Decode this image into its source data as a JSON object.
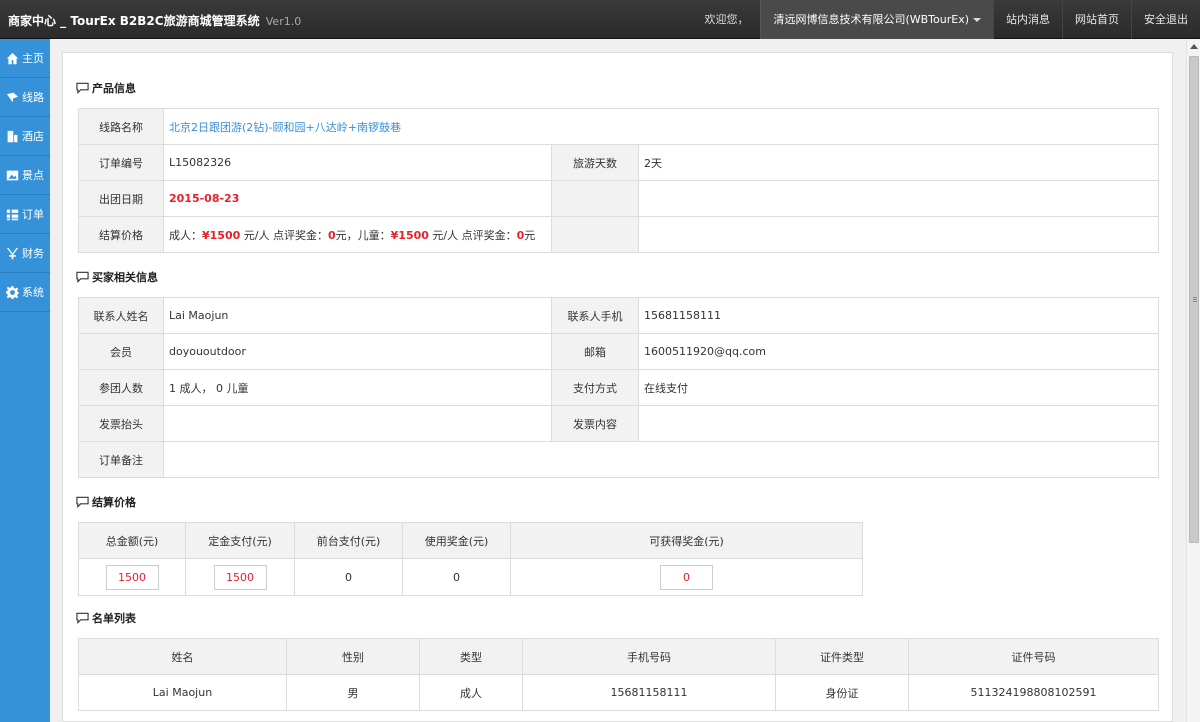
{
  "header": {
    "brand": "商家中心 _ TourEx B2B2C旅游商城管理系统",
    "version": "Ver1.0",
    "welcome": "欢迎您，",
    "company": "清远网博信息技术有限公司(WBTourEx)",
    "messages": "站内消息",
    "homepage": "网站首页",
    "logout": "安全退出"
  },
  "sidebar": {
    "items": [
      {
        "label": "主页",
        "icon": "home-icon"
      },
      {
        "label": "线路",
        "icon": "route-icon"
      },
      {
        "label": "酒店",
        "icon": "building-icon"
      },
      {
        "label": "景点",
        "icon": "picture-icon"
      },
      {
        "label": "订单",
        "icon": "list-icon"
      },
      {
        "label": "财务",
        "icon": "yen-icon"
      },
      {
        "label": "系统",
        "icon": "gear-icon"
      }
    ]
  },
  "product": {
    "title": "产品信息",
    "route_label": "线路名称",
    "route_value": "北京2日跟团游(2钻)-颐和园+八达岭+南锣鼓巷",
    "order_no_label": "订单编号",
    "order_no_value": "L15082326",
    "days_label": "旅游天数",
    "days_value": "2天",
    "depart_label": "出团日期",
    "depart_value": "2015-08-23",
    "price_label": "结算价格",
    "price_adult_prefix": "成人：",
    "price_adult": "¥1500",
    "price_adult_mid": " 元/人 点评奖金：",
    "price_adult_bonus": "0",
    "price_child_prefix": "元，儿童：",
    "price_child": "¥1500",
    "price_child_mid": " 元/人 点评奖金：",
    "price_child_bonus": "0",
    "price_suffix": "元"
  },
  "buyer": {
    "title": "买家相关信息",
    "contact_name_label": "联系人姓名",
    "contact_name_value": "Lai Maojun",
    "contact_phone_label": "联系人手机",
    "contact_phone_value": "15681158111",
    "member_label": "会员",
    "member_value": "doyououtdoor",
    "email_label": "邮箱",
    "email_value": "1600511920@qq.com",
    "people_label": "参团人数",
    "people_value": "1 成人， 0 儿童",
    "pay_label": "支付方式",
    "pay_value": "在线支付",
    "invoice_title_label": "发票抬头",
    "invoice_content_label": "发票内容",
    "remark_label": "订单备注"
  },
  "settlement": {
    "title": "结算价格",
    "headers": [
      "总金额(元)",
      "定金支付(元)",
      "前台支付(元)",
      "使用奖金(元)",
      "可获得奖金(元)"
    ],
    "total": "1500",
    "deposit": "1500",
    "front_pay": "0",
    "bonus_used": "0",
    "bonus_earn": "0"
  },
  "roster": {
    "title": "名单列表",
    "headers": [
      "姓名",
      "性别",
      "类型",
      "手机号码",
      "证件类型",
      "证件号码"
    ],
    "rows": [
      [
        "Lai Maojun",
        "男",
        "成人",
        "15681158111",
        "身份证",
        "511324198808102591"
      ]
    ]
  }
}
